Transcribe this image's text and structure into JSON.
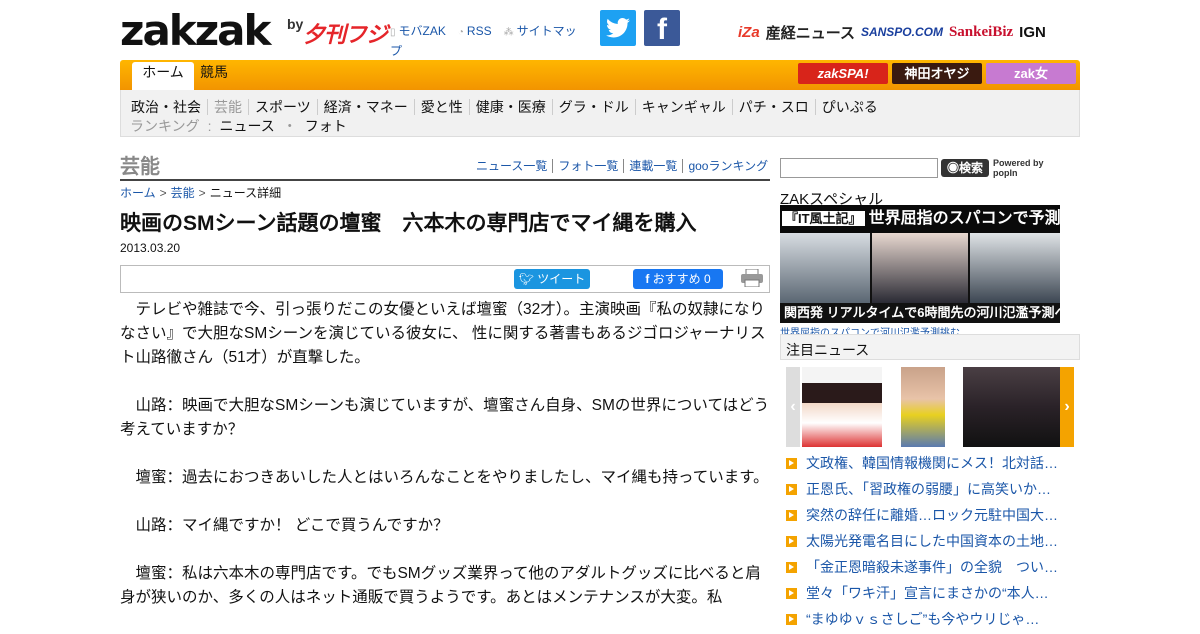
{
  "header": {
    "logo": "zakzak",
    "logo_by": "by",
    "logo_fuji": "夕刊フジ",
    "top_links": [
      "モバZAK",
      "RSS",
      "サイトマップ"
    ],
    "partners": [
      "iZa",
      "産経ニュース",
      "SANSPO.COM",
      "SankeiBiz",
      "IGN"
    ]
  },
  "nav": {
    "tabs": [
      "ホーム",
      "競馬"
    ],
    "badges": [
      "zakSPA!",
      "神田オヤジ",
      "zak女"
    ],
    "categories": [
      "政治・社会",
      "芸能",
      "スポーツ",
      "経済・マネー",
      "愛と性",
      "健康・医療",
      "グラ・ドル",
      "キャンギャル",
      "パチ・スロ",
      "ぴいぷる"
    ],
    "ranking_label": "ランキング",
    "ranking_items": [
      "ニュース",
      "フォト"
    ]
  },
  "section": {
    "title": "芸能",
    "links": [
      "ニュース一覧",
      "フォト一覧",
      "連載一覧",
      "gooランキング"
    ]
  },
  "breadcrumb": [
    "ホーム",
    "芸能",
    "ニュース詳細"
  ],
  "article": {
    "headline": "映画のSMシーン話題の壇蜜　六本木の専門店でマイ縄を購入",
    "date": "2013.03.20",
    "tweet_label": "ツイート",
    "fb_label": "おすすめ 0",
    "paragraphs": [
      "テレビや雑誌で今、引っ張りだこの女優といえば壇蜜（32才）。主演映画『私の奴隷になりなさい』で大胆なSMシーンを演じている彼女に、 性に関する著書もあるジゴロジャーナリスト山路徹さん（51才）が直撃した。",
      "山路：映画で大胆なSMシーンも演じていますが、壇蜜さん自身、SMの世界についてはどう考えていますか？",
      "壇蜜：過去におつきあいした人とはいろんなことをやりましたし、マイ縄も持っています。",
      "山路：マイ縄ですか！ どこで買うんですか？",
      "壇蜜：私は六本木の専門店です。でもSMグッズ業界って他のアダルトグッズに比べると肩身が狭いのか、多くの人はネット通販で買うようです。あとはメンテナンスが大変。私"
    ]
  },
  "sidebar": {
    "search_button": "検索",
    "popin_label": "Powered by popIn",
    "zak_special_title": "ZAKスペシャル",
    "banner_tag": "『IT風土記』",
    "banner_headline": "世界屈指のスパコンで予測？",
    "banner_sub": "関西発 リアルタイムで6時間先の河川氾濫予測へ",
    "banner_caption": "世界屈指のスパコンで河川氾濫予測挑む",
    "chumoku_title": "注目ニュース",
    "news": [
      "文政権、韓国情報機関にメス！北対話…",
      "正恩氏、「習政権の弱腰」に高笑いか…",
      "突然の辞任に離婚…ロック元駐中国大…",
      "太陽光発電名目にした中国資本の土地…",
      "「金正恩暗殺未遂事件」の全貌　つい…",
      "堂々「ワキ汗」宣言にまさかの“本人…",
      "“まゆゆｖｓさしご”も今やウリじゃ…"
    ]
  },
  "colors": {
    "accent_orange": "#f29400",
    "link_blue": "#1a56a8",
    "twitter": "#1da1f2",
    "facebook": "#3b5998"
  }
}
